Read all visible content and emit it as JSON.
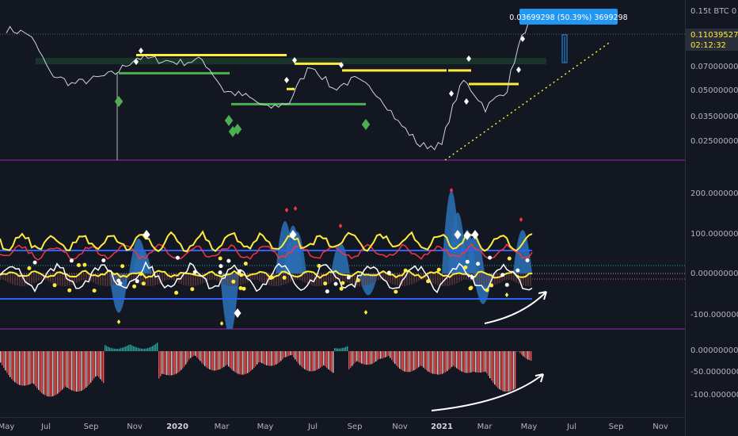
{
  "header": {
    "symbol_label": "0.15t BTC 0",
    "measure_badge": "0.03699298 (50.39%) 3699298",
    "price_tag": "0.11039527",
    "countdown_tag": "02:12:32"
  },
  "colors": {
    "background": "#131722",
    "price_line": "#d1d4dc",
    "yellow_level": "#ffeb3b",
    "green_level": "#4caf50",
    "band": "#1b3a2a",
    "pane_border": "#9c27b0",
    "oscillator_blue": "#2962ff",
    "oscillator_red": "#f23645",
    "histogram_green": "#26a69a",
    "histogram_red": "#ef5350",
    "badge_blue": "#2196f3",
    "price_tag_bg": "#2a2e39"
  },
  "chart_data": [
    {
      "type": "line",
      "pane": "price",
      "title": "",
      "x_ticks": [
        "May",
        "Jul",
        "Sep",
        "Nov",
        "2020",
        "Mar",
        "May",
        "Jul",
        "Sep",
        "Nov",
        "2021",
        "Mar",
        "May",
        "Jul",
        "Sep",
        "Nov"
      ],
      "y_ticks": [
        "0.07000000",
        "0.05000000",
        "0.03500000",
        "0.02500000"
      ],
      "ylim": [
        0.022,
        0.13
      ],
      "series": [
        {
          "name": "",
          "x": [
            "2019-05",
            "2019-06",
            "2019-07",
            "2019-08",
            "2019-09",
            "2019-10",
            "2019-11",
            "2019-12",
            "2020-01",
            "2020-02",
            "2020-03",
            "2020-04",
            "2020-05",
            "2020-06",
            "2020-07",
            "2020-08",
            "2020-09",
            "2020-10",
            "2020-11",
            "2020-12",
            "2021-01",
            "2021-02",
            "2021-03",
            "2021-04",
            "2021-05"
          ],
          "values": [
            0.1,
            0.095,
            0.06,
            0.053,
            0.056,
            0.06,
            0.072,
            0.07,
            0.068,
            0.07,
            0.049,
            0.046,
            0.04,
            0.043,
            0.066,
            0.05,
            0.056,
            0.048,
            0.034,
            0.026,
            0.026,
            0.055,
            0.04,
            0.05,
            0.11
          ]
        }
      ],
      "levels": [
        {
          "color": "yellow",
          "value": 0.074
        },
        {
          "color": "yellow",
          "value": 0.067
        },
        {
          "color": "yellow",
          "value": 0.062
        },
        {
          "color": "yellow",
          "value": 0.062
        },
        {
          "color": "yellow",
          "value": 0.053
        },
        {
          "color": "yellow",
          "value": 0.05
        },
        {
          "color": "green",
          "value": 0.06
        },
        {
          "color": "green",
          "value": 0.042
        }
      ]
    },
    {
      "type": "line",
      "pane": "oscillator",
      "title": "",
      "y_ticks": [
        "200.00000000",
        "100.00000000",
        "0.00000000",
        "-100.00000000"
      ],
      "ylim": [
        -130,
        260
      ]
    },
    {
      "type": "bar",
      "pane": "histogram",
      "title": "",
      "y_ticks": [
        "0.00000000",
        "-50.00000000",
        "-100.00000000"
      ],
      "ylim": [
        -135,
        30
      ]
    }
  ]
}
